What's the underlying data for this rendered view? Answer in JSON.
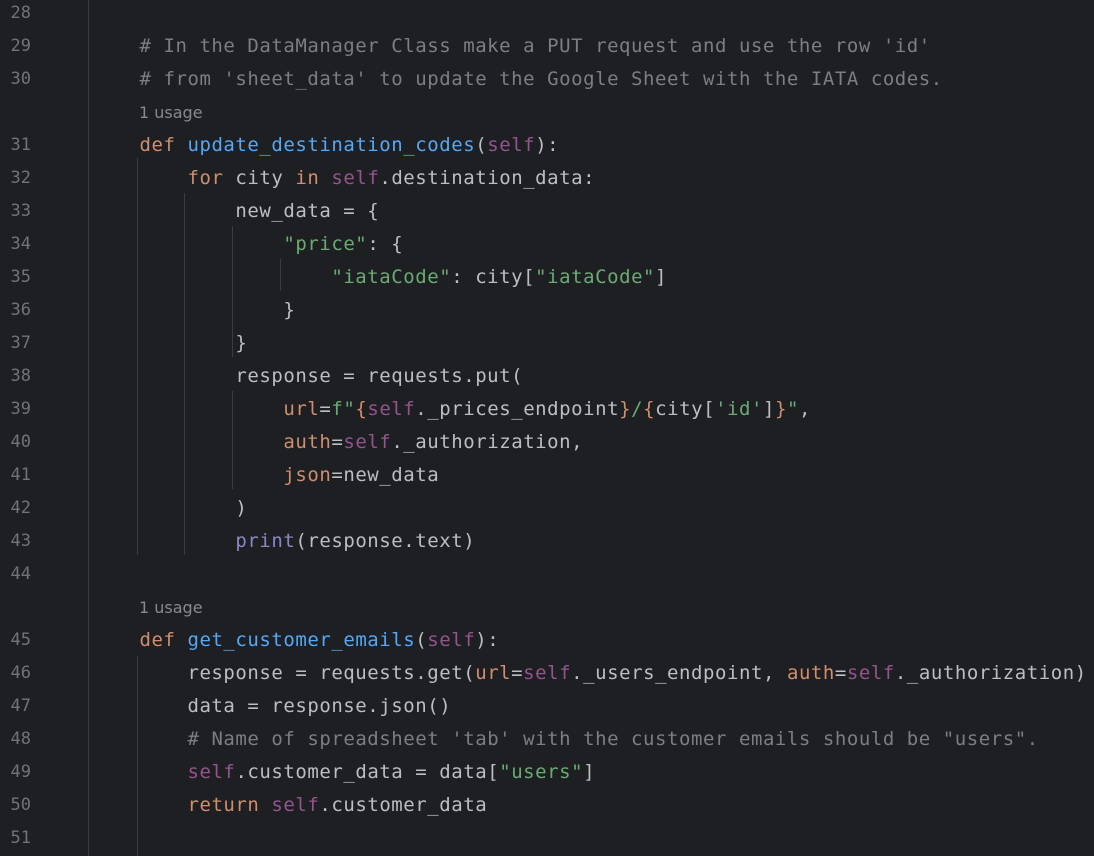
{
  "editor": {
    "lines": [
      {
        "type": "code",
        "num": "28",
        "tokens": []
      },
      {
        "type": "code",
        "num": "29",
        "tokens": [
          {
            "t": "# In the DataManager Class make a PUT request and use the row 'id'",
            "c": "cm"
          }
        ]
      },
      {
        "type": "code",
        "num": "30",
        "tokens": [
          {
            "t": "# from 'sheet_data' to update the Google Sheet with the IATA codes.",
            "c": "cm"
          }
        ]
      },
      {
        "type": "hint",
        "text": "1 usage"
      },
      {
        "type": "code",
        "num": "31",
        "tokens": [
          {
            "t": "def",
            "c": "kw"
          },
          {
            "t": " ",
            "c": ""
          },
          {
            "t": "update_destination_codes",
            "c": "fn"
          },
          {
            "t": "(",
            "c": ""
          },
          {
            "t": "self",
            "c": "self"
          },
          {
            "t": "):",
            "c": ""
          }
        ]
      },
      {
        "type": "code",
        "num": "32",
        "tokens": [
          {
            "t": "    ",
            "c": ""
          },
          {
            "t": "for",
            "c": "kw"
          },
          {
            "t": " city ",
            "c": ""
          },
          {
            "t": "in",
            "c": "kw"
          },
          {
            "t": " ",
            "c": ""
          },
          {
            "t": "self",
            "c": "self"
          },
          {
            "t": ".destination_data:",
            "c": ""
          }
        ]
      },
      {
        "type": "code",
        "num": "33",
        "tokens": [
          {
            "t": "        new_data = {",
            "c": ""
          }
        ]
      },
      {
        "type": "code",
        "num": "34",
        "tokens": [
          {
            "t": "            ",
            "c": ""
          },
          {
            "t": "\"price\"",
            "c": "str"
          },
          {
            "t": ": {",
            "c": ""
          }
        ]
      },
      {
        "type": "code",
        "num": "35",
        "tokens": [
          {
            "t": "                ",
            "c": ""
          },
          {
            "t": "\"iataCode\"",
            "c": "str"
          },
          {
            "t": ": city[",
            "c": ""
          },
          {
            "t": "\"iataCode\"",
            "c": "str"
          },
          {
            "t": "]",
            "c": ""
          }
        ]
      },
      {
        "type": "code",
        "num": "36",
        "tokens": [
          {
            "t": "            }",
            "c": ""
          }
        ]
      },
      {
        "type": "code",
        "num": "37",
        "tokens": [
          {
            "t": "        }",
            "c": ""
          }
        ]
      },
      {
        "type": "code",
        "num": "38",
        "tokens": [
          {
            "t": "        response = requests.put(",
            "c": ""
          }
        ]
      },
      {
        "type": "code",
        "num": "39",
        "tokens": [
          {
            "t": "            ",
            "c": ""
          },
          {
            "t": "url",
            "c": "param"
          },
          {
            "t": "=",
            "c": ""
          },
          {
            "t": "f\"",
            "c": "str"
          },
          {
            "t": "{",
            "c": "kw"
          },
          {
            "t": "self",
            "c": "self"
          },
          {
            "t": "._prices_endpoint",
            "c": ""
          },
          {
            "t": "}",
            "c": "kw"
          },
          {
            "t": "/",
            "c": "str"
          },
          {
            "t": "{",
            "c": "kw"
          },
          {
            "t": "city[",
            "c": ""
          },
          {
            "t": "'id'",
            "c": "str"
          },
          {
            "t": "]",
            "c": ""
          },
          {
            "t": "}",
            "c": "kw"
          },
          {
            "t": "\"",
            "c": "str"
          },
          {
            "t": ",",
            "c": ""
          }
        ]
      },
      {
        "type": "code",
        "num": "40",
        "tokens": [
          {
            "t": "            ",
            "c": ""
          },
          {
            "t": "auth",
            "c": "param"
          },
          {
            "t": "=",
            "c": ""
          },
          {
            "t": "self",
            "c": "self"
          },
          {
            "t": "._authorization,",
            "c": ""
          }
        ]
      },
      {
        "type": "code",
        "num": "41",
        "tokens": [
          {
            "t": "            ",
            "c": ""
          },
          {
            "t": "json",
            "c": "param"
          },
          {
            "t": "=new_data",
            "c": ""
          }
        ]
      },
      {
        "type": "code",
        "num": "42",
        "tokens": [
          {
            "t": "        )",
            "c": ""
          }
        ]
      },
      {
        "type": "code",
        "num": "43",
        "tokens": [
          {
            "t": "        ",
            "c": ""
          },
          {
            "t": "print",
            "c": "builtin"
          },
          {
            "t": "(response.text)",
            "c": ""
          }
        ]
      },
      {
        "type": "code",
        "num": "44",
        "tokens": []
      },
      {
        "type": "hint",
        "text": "1 usage"
      },
      {
        "type": "code",
        "num": "45",
        "tokens": [
          {
            "t": "def",
            "c": "kw"
          },
          {
            "t": " ",
            "c": ""
          },
          {
            "t": "get_customer_emails",
            "c": "fn"
          },
          {
            "t": "(",
            "c": ""
          },
          {
            "t": "self",
            "c": "self"
          },
          {
            "t": "):",
            "c": ""
          }
        ]
      },
      {
        "type": "code",
        "num": "46",
        "tokens": [
          {
            "t": "    response = requests.get(",
            "c": ""
          },
          {
            "t": "url",
            "c": "param"
          },
          {
            "t": "=",
            "c": ""
          },
          {
            "t": "self",
            "c": "self"
          },
          {
            "t": "._users_endpoint, ",
            "c": ""
          },
          {
            "t": "auth",
            "c": "param"
          },
          {
            "t": "=",
            "c": ""
          },
          {
            "t": "self",
            "c": "self"
          },
          {
            "t": "._authorization)",
            "c": ""
          }
        ]
      },
      {
        "type": "code",
        "num": "47",
        "tokens": [
          {
            "t": "    data = response.json()",
            "c": ""
          }
        ]
      },
      {
        "type": "code",
        "num": "48",
        "tokens": [
          {
            "t": "    ",
            "c": ""
          },
          {
            "t": "# Name of spreadsheet 'tab' with the customer emails should be \"users\".",
            "c": "cm"
          }
        ]
      },
      {
        "type": "code",
        "num": "49",
        "tokens": [
          {
            "t": "    ",
            "c": ""
          },
          {
            "t": "self",
            "c": "self"
          },
          {
            "t": ".customer_data = data[",
            "c": ""
          },
          {
            "t": "\"users\"",
            "c": "str"
          },
          {
            "t": "]",
            "c": ""
          }
        ]
      },
      {
        "type": "code",
        "num": "50",
        "tokens": [
          {
            "t": "    ",
            "c": ""
          },
          {
            "t": "return",
            "c": "kw"
          },
          {
            "t": " ",
            "c": ""
          },
          {
            "t": "self",
            "c": "self"
          },
          {
            "t": ".customer_data",
            "c": ""
          }
        ]
      },
      {
        "type": "code",
        "num": "51",
        "tokens": []
      }
    ]
  },
  "colors": {
    "background": "#1e1f22",
    "text": "#bcbec4",
    "keyword": "#cf8e6d",
    "function": "#56a8f5",
    "self": "#94558d",
    "string": "#6aab73",
    "comment": "#7a7e85",
    "builtin": "#8888c6",
    "line_number": "#6f737a",
    "hint": "#868a91"
  }
}
